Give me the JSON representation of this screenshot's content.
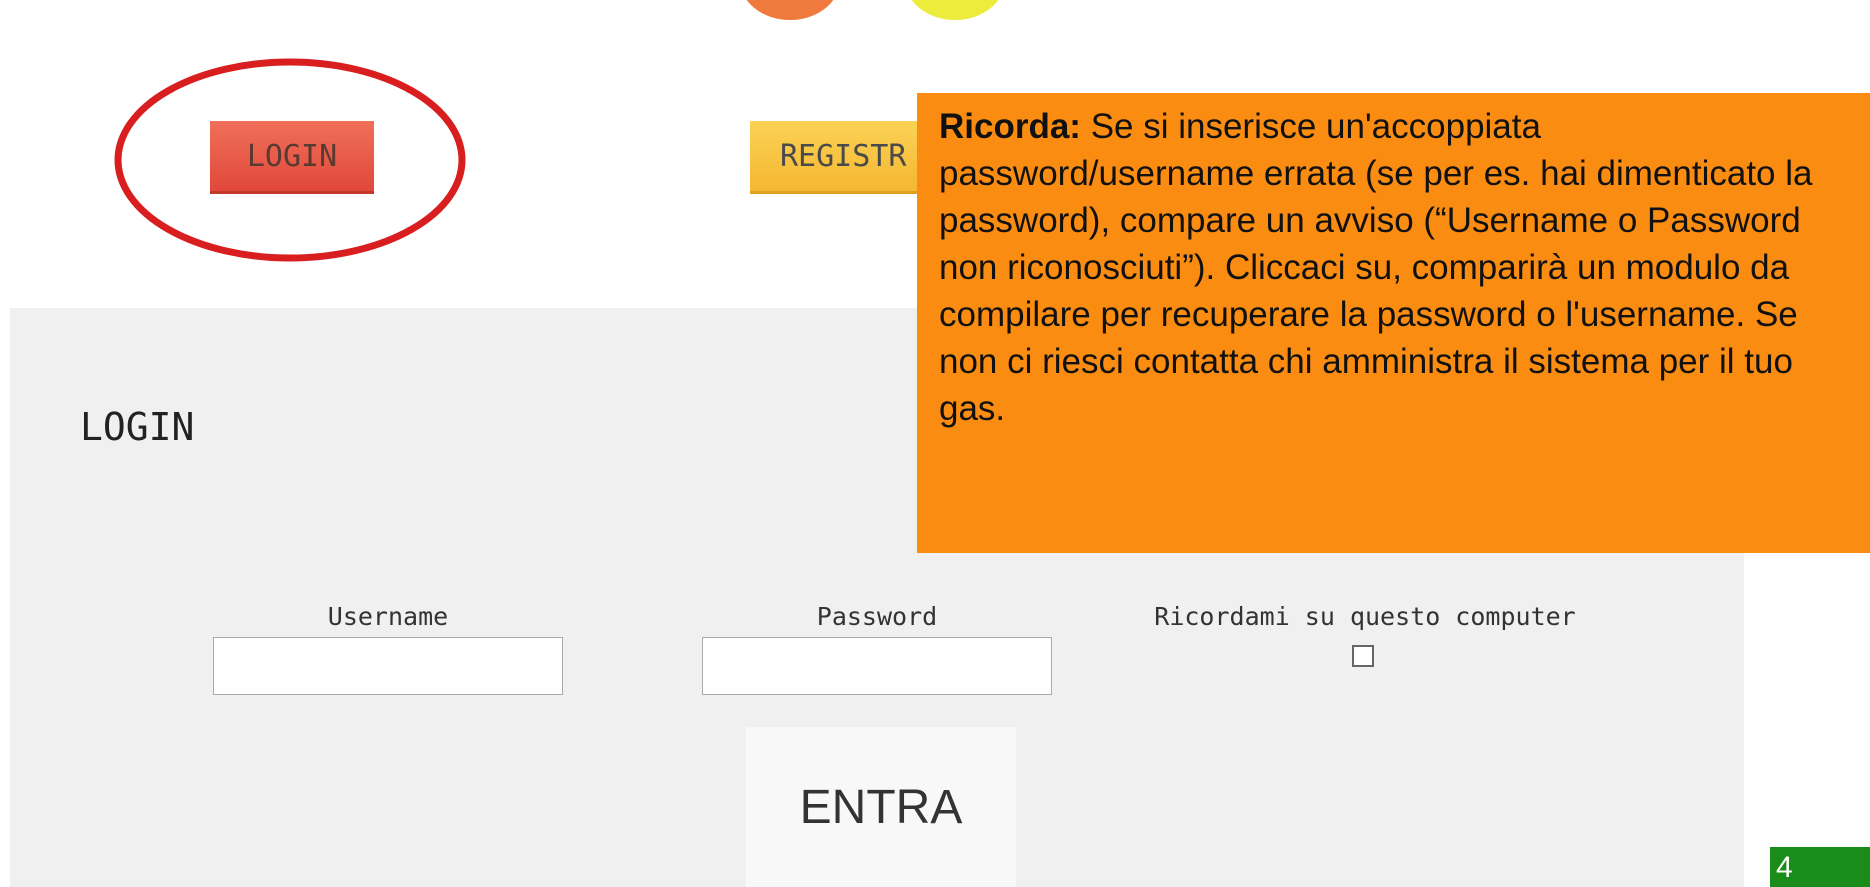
{
  "header": {
    "login_button": "LOGIN",
    "register_button": "REGISTR"
  },
  "login_panel": {
    "title": "LOGIN",
    "username_label": "Username",
    "username_value": "",
    "password_label": "Password",
    "password_value": "",
    "remember_label": "Ricordami su questo computer",
    "remember_checked": false,
    "submit_label": "ENTRA"
  },
  "note": {
    "heading": "Ricorda:",
    "text": " Se si inserisce un'accoppiata password/username errata (se per es. hai dimenticato la password), compare un avviso (“Username o Password non riconosciuti”). Cliccaci su, comparirà un modulo da compilare per recuperare la password o l'username. Se non ci riesci contatta chi amministra il sistema per il tuo gas."
  },
  "slide": {
    "number": "4"
  },
  "colors": {
    "note_bg": "#fa8c12",
    "login_button": "#e85a44",
    "register_button": "#f5b731",
    "ring": "#d81e1e",
    "slide_badge": "#1a8c1a"
  }
}
